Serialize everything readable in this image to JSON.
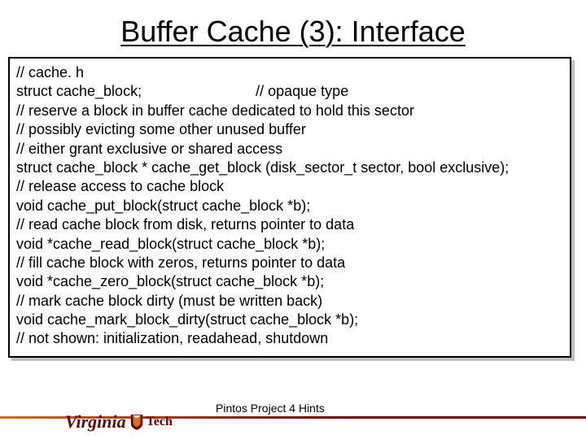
{
  "title": "Buffer Cache (3): Interface",
  "code": {
    "l0": "// cache. h",
    "l1a": "struct cache_block;",
    "l1b": "// opaque type",
    "l2": "// reserve a block in buffer cache dedicated to hold this sector",
    "l3": "// possibly evicting some other unused buffer",
    "l4": "// either grant exclusive or shared access",
    "l5": "struct cache_block * cache_get_block (disk_sector_t sector, bool exclusive);",
    "l6": "// release access to cache block",
    "l7": "void cache_put_block(struct cache_block *b);",
    "l8": "// read cache block from disk, returns pointer to data",
    "l9": "void *cache_read_block(struct cache_block *b);",
    "l10": "// fill cache block with zeros, returns pointer to data",
    "l11": "void *cache_zero_block(struct cache_block *b);",
    "l12": "// mark cache block dirty (must be written back)",
    "l13": "void cache_mark_block_dirty(struct cache_block *b);",
    "l14": "// not shown: initialization, readahead, shutdown"
  },
  "footer": {
    "text": "Pintos Project 4 Hints",
    "logo_left": "Virginia",
    "logo_right": "Tech"
  },
  "colors": {
    "maroon": "#6b0000",
    "orange": "#d2691e"
  }
}
